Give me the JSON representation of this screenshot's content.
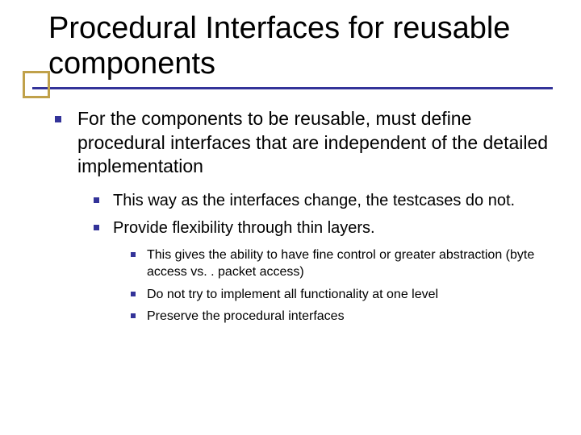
{
  "title": "Procedural Interfaces for reusable components",
  "bullets": {
    "l1": "For the components to be reusable, must define procedural interfaces that are independent of the detailed implementation",
    "l2a": "This way as the interfaces change, the testcases do not.",
    "l2b": "Provide flexibility through thin layers.",
    "l3a": "This gives the ability to have fine control or greater abstraction (byte access vs. . packet access)",
    "l3b": "Do not try to implement all functionality at one level",
    "l3c": "Preserve the procedural interfaces"
  }
}
